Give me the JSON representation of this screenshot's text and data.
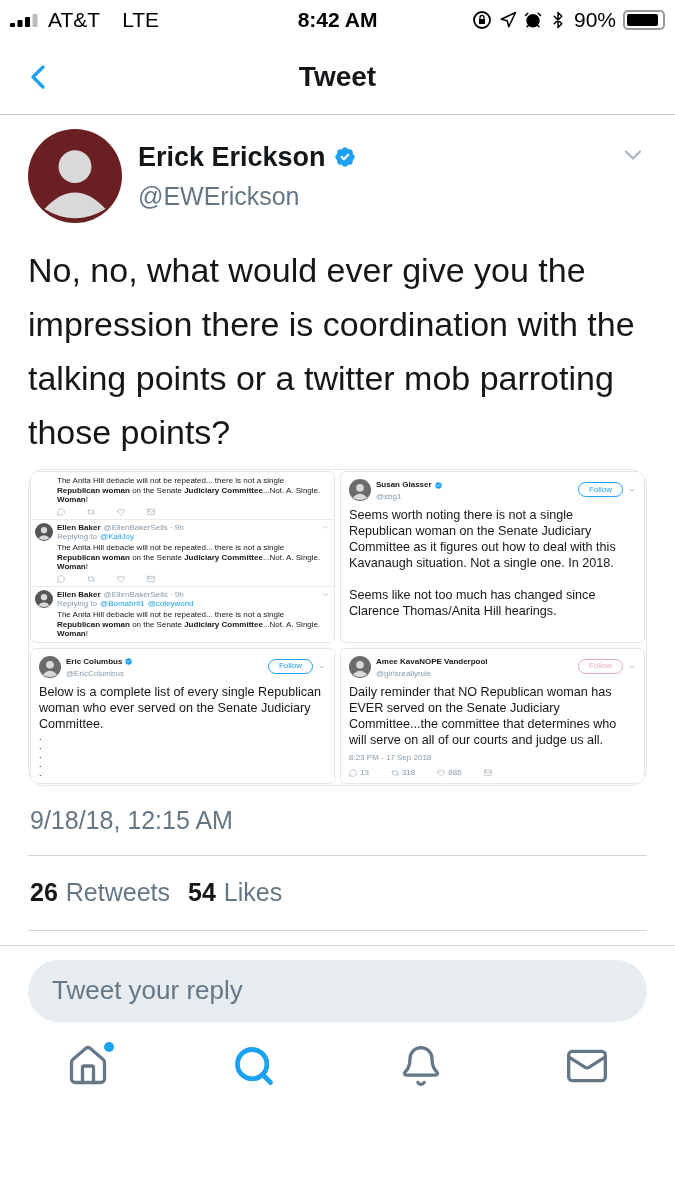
{
  "status_bar": {
    "carrier": "AT&T",
    "network": "LTE",
    "time": "8:42 AM",
    "battery": "90%"
  },
  "nav": {
    "title": "Tweet"
  },
  "tweet": {
    "author": {
      "name": "Erick Erickson",
      "handle": "@EWErickson",
      "verified": true
    },
    "text": "No, no, what would ever give you the impression there is coordination with the talking points or a twitter mob parroting those points?",
    "media": {
      "panels": [
        {
          "kind": "thread",
          "items": [
            {
              "text": "The Anita Hill debacle will not be repeated... there is not a single **Republican woman** on the Senate **Judiciary Committee**...Not. A. Single. **Woman**!",
              "show_actions": true
            },
            {
              "name": "Ellen Baker",
              "handle": "@EllenBakerSells · 9h",
              "replying_label": "Replying to",
              "reply_to": [
                "@KaliJoy"
              ],
              "text": "The Anita Hill debacle will not be repeated... there is not a single **Republican woman** on the Senate **Judiciary Committee**...Not. A. Single. **Woman**!",
              "show_actions": true
            },
            {
              "name": "Ellen Baker",
              "handle": "@EllenBakerSells · 9h",
              "replying_label": "Replying to",
              "reply_to": [
                "@Bomabrit1",
                "@coleyworld"
              ],
              "text": "The Anita Hill debacle will not be repeated... there is not a single **Republican woman** on the Senate **Judiciary Committee**...Not. A. Single. **Woman**!",
              "show_actions": false
            }
          ]
        },
        {
          "kind": "tweet",
          "name": "Susan Glasser",
          "handle": "@sbg1",
          "verified": true,
          "follow": "Follow",
          "color": "#1da1f2",
          "paragraphs": [
            "Seems worth noting there is not a single Republican woman on the Senate Judiciary Committee as it figures out how to deal with this Kavanaugh situation. Not a single one. In 2018.",
            "Seems like not too much has changed since Clarence Thomas/Anita Hill hearings."
          ]
        },
        {
          "kind": "tweet",
          "name": "Eric Columbus",
          "handle": "@EricColumbus",
          "verified": true,
          "follow": "Follow",
          "color": "#1da1f2",
          "paragraphs": [
            "Below is a complete list of every single Republican woman who ever served on the Senate Judiciary Committee."
          ],
          "list_marks": [
            ".",
            ".",
            ".",
            ".",
            "."
          ]
        },
        {
          "kind": "tweet",
          "name": "Amee KavaNOPE Vanderpool",
          "handle": "@girlsreallyrule",
          "verified": false,
          "follow": "Follow",
          "color": "#e8a6c4",
          "paragraphs": [
            "Daily reminder that NO Republican woman has EVER served on the Senate Judiciary Committee...the committee that determines who will serve on all of our courts and judge us all."
          ],
          "timestamp": "8:23 PM - 17 Sep 2018",
          "stats": [
            "13",
            "318",
            "686"
          ]
        }
      ]
    },
    "timestamp": "9/18/18, 12:15 AM",
    "stats": [
      {
        "count": "26",
        "label": "Retweets"
      },
      {
        "count": "54",
        "label": "Likes"
      }
    ]
  },
  "reply_field": {
    "placeholder": "Tweet your reply"
  },
  "tab_bar": [
    {
      "kind": "home",
      "selected": false,
      "has_update": true
    },
    {
      "kind": "search",
      "selected": true,
      "has_update": false
    },
    {
      "kind": "notifications",
      "selected": false,
      "has_update": false
    },
    {
      "kind": "messages",
      "selected": false,
      "has_update": false
    }
  ]
}
